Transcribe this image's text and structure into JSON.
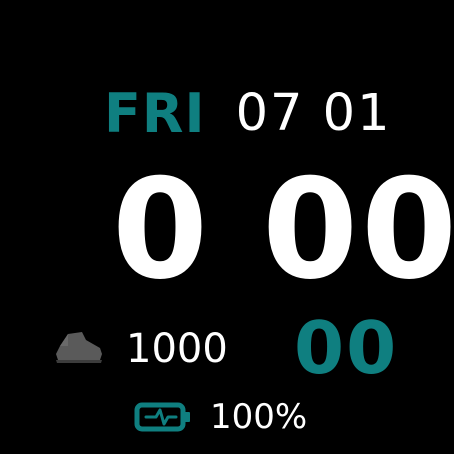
{
  "colors": {
    "accent": "#0f7f80",
    "text": "#ffffff",
    "icon_gray": "#5a5a5a",
    "background": "#000000"
  },
  "date_row": {
    "day": "FRI",
    "date": "07 01"
  },
  "time": {
    "hours_minutes": "0 00",
    "seconds": "00"
  },
  "steps": {
    "icon": "shoe-icon",
    "value": "1000"
  },
  "battery": {
    "icon": "battery-charging-icon",
    "value": "100%"
  }
}
